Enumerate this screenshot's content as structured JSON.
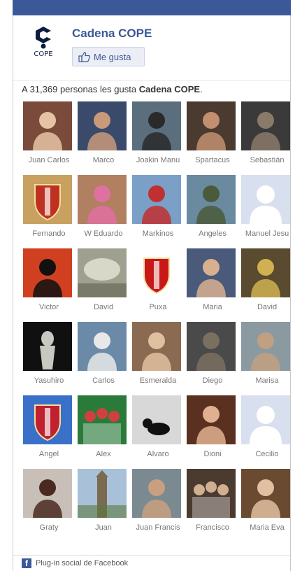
{
  "page": {
    "name": "Cadena COPE",
    "logo_text": "COPE",
    "like_label": "Me gusta"
  },
  "summary": {
    "prefix": "A 31,369 personas les gusta ",
    "page_name": "Cadena COPE",
    "suffix": "."
  },
  "fans": [
    {
      "name": "Juan Carlos",
      "bg": "#7a4a3a",
      "fg": "#e6c3a5",
      "icon": "person-photo"
    },
    {
      "name": "Marco",
      "bg": "#3a4a6a",
      "fg": "#c89a7a",
      "icon": "person-photo"
    },
    {
      "name": "Joakin Manu",
      "bg": "#5a6e7e",
      "fg": "#2a2a2a",
      "icon": "person-photo"
    },
    {
      "name": "Spartacus",
      "bg": "#4a3a30",
      "fg": "#c29070",
      "icon": "person-photo"
    },
    {
      "name": "Sebastián",
      "bg": "#3a3a3a",
      "fg": "#8a7a6a",
      "icon": "person-photo"
    },
    {
      "name": "Fernando",
      "bg": "#c8a060",
      "fg": "#c03020",
      "icon": "crest-photo"
    },
    {
      "name": "W Eduardo",
      "bg": "#b08060",
      "fg": "#e070a0",
      "icon": "person-photo"
    },
    {
      "name": "Markinos",
      "bg": "#7aa0c8",
      "fg": "#c03030",
      "icon": "person-photo"
    },
    {
      "name": "Angeles",
      "bg": "#6a8aa0",
      "fg": "#4a5a3a",
      "icon": "person-photo"
    },
    {
      "name": "Manuel Jesu",
      "bg": "#d8dfee",
      "fg": "#ffffff",
      "icon": "default-avatar"
    },
    {
      "name": "Victor",
      "bg": "#d04020",
      "fg": "#111111",
      "icon": "person-photo"
    },
    {
      "name": "David",
      "bg": "#a0a090",
      "fg": "#d8d8c8",
      "icon": "landscape-photo"
    },
    {
      "name": "Puxa",
      "bg": "#ffffff",
      "fg": "#c81818",
      "icon": "crest-photo"
    },
    {
      "name": "Maria",
      "bg": "#4a5a7a",
      "fg": "#d8b090",
      "icon": "person-photo"
    },
    {
      "name": "David",
      "bg": "#5a4a30",
      "fg": "#d0b050",
      "icon": "person-photo"
    },
    {
      "name": "Yasuhiro",
      "bg": "#101010",
      "fg": "#c8c8c0",
      "icon": "statue-photo"
    },
    {
      "name": "Carlos",
      "bg": "#6a8aa8",
      "fg": "#e8e8e8",
      "icon": "person-photo"
    },
    {
      "name": "Esmeralda",
      "bg": "#8a6a50",
      "fg": "#e0c0a0",
      "icon": "person-photo"
    },
    {
      "name": "Diego",
      "bg": "#4a4a4a",
      "fg": "#7a7060",
      "icon": "person-photo"
    },
    {
      "name": "Marisa",
      "bg": "#8a9aa0",
      "fg": "#c0a080",
      "icon": "person-photo"
    },
    {
      "name": "Angel",
      "bg": "#3a70c8",
      "fg": "#c02030",
      "icon": "crest-photo"
    },
    {
      "name": "Alex",
      "bg": "#2a7a3a",
      "fg": "#d04040",
      "icon": "group-photo"
    },
    {
      "name": "Alvaro",
      "bg": "#d8d8d8",
      "fg": "#101010",
      "icon": "cat-photo"
    },
    {
      "name": "Dioni",
      "bg": "#5a3020",
      "fg": "#e0b090",
      "icon": "person-photo"
    },
    {
      "name": "Cecilio",
      "bg": "#d8dfee",
      "fg": "#ffffff",
      "icon": "default-avatar"
    },
    {
      "name": "Graty",
      "bg": "#c8c0b8",
      "fg": "#4a2a20",
      "icon": "person-photo"
    },
    {
      "name": "Juan",
      "bg": "#a8c0d8",
      "fg": "#7a6a50",
      "icon": "tower-photo"
    },
    {
      "name": "Juan Francis",
      "bg": "#7a8a90",
      "fg": "#c8a080",
      "icon": "person-photo"
    },
    {
      "name": "Francisco",
      "bg": "#4a3a30",
      "fg": "#d0b090",
      "icon": "group-photo"
    },
    {
      "name": "Maria Eva",
      "bg": "#6a4a30",
      "fg": "#e0c0a0",
      "icon": "person-photo"
    }
  ],
  "footer": {
    "icon_letter": "f",
    "text": "Plug-in social de Facebook"
  },
  "colors": {
    "brand": "#3b5998",
    "button_bg": "#eceef5"
  }
}
